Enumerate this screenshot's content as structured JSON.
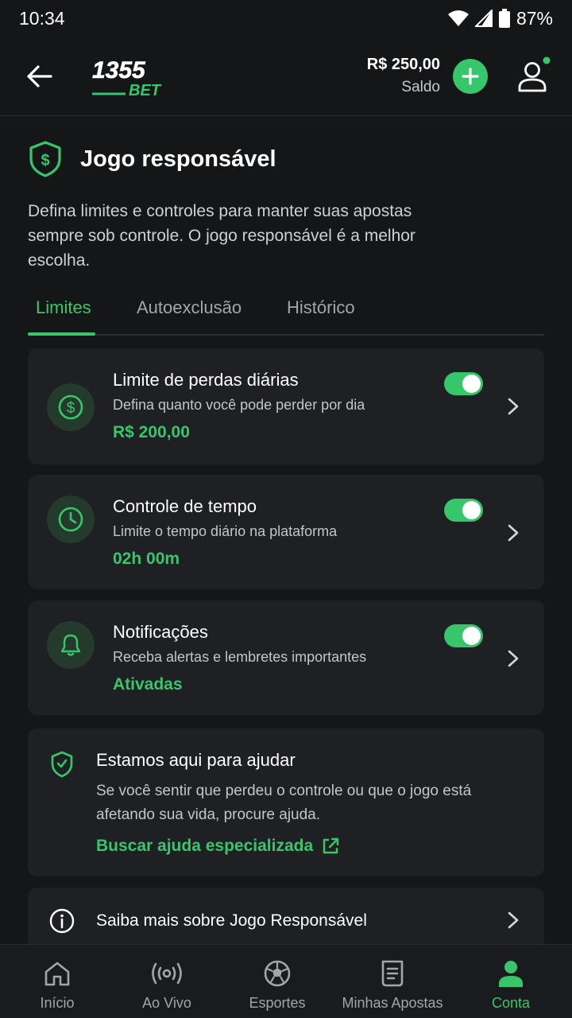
{
  "status_bar": {
    "time": "10:34",
    "battery": "87%"
  },
  "header": {
    "logo_top": "1355",
    "logo_bottom": "BET",
    "balance_amount": "R$ 250,00",
    "balance_label": "Saldo"
  },
  "page": {
    "title": "Jogo responsável",
    "description": "Defina limites e controles para manter suas apostas sempre sob controle. O jogo responsável é a melhor escolha."
  },
  "tabs": [
    "Limites",
    "Autoexclusão",
    "Histórico"
  ],
  "cards": [
    {
      "title": "Limite de perdas diárias",
      "subtitle": "Defina quanto você pode perder por dia",
      "value": "R$ 200,00",
      "icon": "dollar-circle-icon",
      "enabled": true
    },
    {
      "title": "Controle de tempo",
      "subtitle": "Limite o tempo diário na plataforma",
      "value": "02h 00m",
      "icon": "clock-icon",
      "enabled": true
    },
    {
      "title": "Notificações",
      "subtitle": "Receba alertas e lembretes importantes",
      "value": "Ativadas",
      "icon": "bell-icon",
      "enabled": true
    }
  ],
  "help": {
    "title": "Estamos aqui para ajudar",
    "text": "Se você sentir que perdeu o controle ou que o jogo está afetando sua vida, procure ajuda.",
    "link": "Buscar ajuda especializada"
  },
  "info": {
    "label": "Saiba mais sobre Jogo Responsável"
  },
  "bottom_nav": [
    "Início",
    "Ao Vivo",
    "Esportes",
    "Minhas Apostas",
    "Conta"
  ],
  "colors": {
    "accent": "#36c76a",
    "background": "#151618",
    "card": "#1f2023"
  }
}
